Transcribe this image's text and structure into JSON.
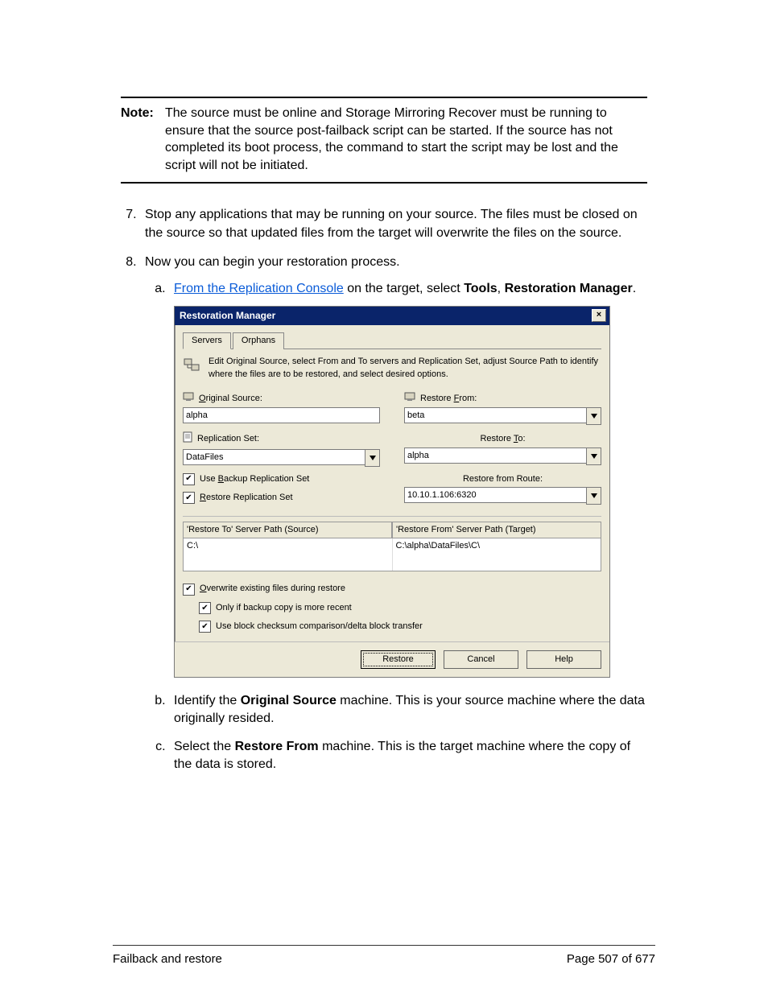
{
  "note": {
    "label": "Note:",
    "text": "The source must be online and Storage Mirroring Recover must be running to ensure that the source post-failback script can be started. If the source has not completed its boot process, the command to start the script may be lost and the script will not be initiated."
  },
  "steps": {
    "s7": "Stop any applications that may be running on your source. The files must be closed on the source so that updated files from the target will overwrite the files on the source.",
    "s8": "Now you can begin your restoration process.",
    "a_link": "From the Replication Console",
    "a_mid": " on the target, select ",
    "a_b1": "Tools",
    "a_sep": ", ",
    "a_b2": "Restoration Manager",
    "a_end": ".",
    "b_pre": "Identify the ",
    "b_b": "Original Source",
    "b_post": " machine. This is your source machine where the data originally resided.",
    "c_pre": "Select the ",
    "c_b": "Restore From",
    "c_post": " machine. This is the target machine where the copy of the data is stored."
  },
  "dialog": {
    "title": "Restoration Manager",
    "tabs": {
      "servers": "Servers",
      "orphans": "Orphans"
    },
    "intro": "Edit Original Source, select From and To servers and Replication Set, adjust Source Path to identify where the files are to be restored, and select desired options.",
    "labels": {
      "original_source": "Original Source:",
      "replication_set": "Replication Set:",
      "use_backup": "Use Backup Replication Set",
      "restore_repl": "Restore Replication Set",
      "restore_from": "Restore From:",
      "restore_to": "Restore To:",
      "restore_route": "Restore from Route:",
      "path_src": "'Restore To' Server Path (Source)",
      "path_tgt": "'Restore From' Server Path (Target)",
      "overwrite": "Overwrite existing files during restore",
      "only_recent": "Only if backup copy is more recent",
      "checksum": "Use block checksum comparison/delta block transfer"
    },
    "values": {
      "original_source": "alpha",
      "replication_set": "DataFiles",
      "restore_from": "beta",
      "restore_to": "alpha",
      "restore_route": "10.10.1.106:6320",
      "path_src": "C:\\",
      "path_tgt": "C:\\alpha\\DataFiles\\C\\"
    },
    "buttons": {
      "restore": "Restore",
      "cancel": "Cancel",
      "help": "Help"
    }
  },
  "footer": {
    "left": "Failback and restore",
    "right": "Page 507 of 677"
  }
}
